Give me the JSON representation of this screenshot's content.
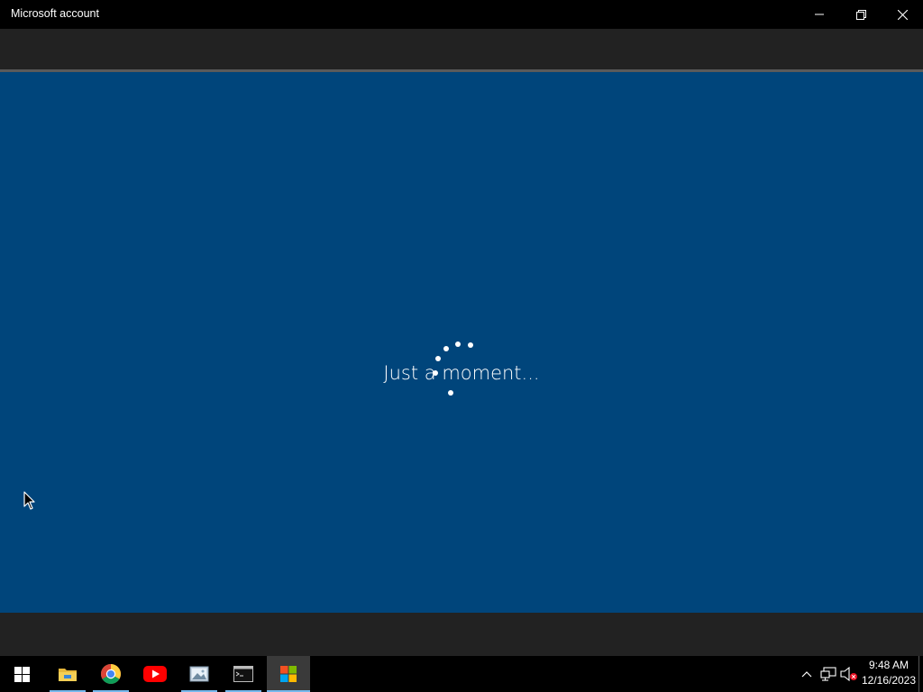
{
  "window": {
    "title": "Microsoft account",
    "controls": {
      "minimize": "minimize-icon",
      "restore": "restore-icon",
      "close": "close-icon"
    }
  },
  "content": {
    "status_text": "Just a moment...",
    "background": "#00457b",
    "spinner": "loading-spinner"
  },
  "taskbar": {
    "start": "windows-start-icon",
    "apps": [
      {
        "name": "File Explorer",
        "icon": "folder-icon",
        "running": true,
        "active": false
      },
      {
        "name": "Google Chrome",
        "icon": "chrome-icon",
        "running": true,
        "active": false
      },
      {
        "name": "YouTube",
        "icon": "youtube-icon",
        "running": false,
        "active": false
      },
      {
        "name": "Photos",
        "icon": "photos-icon",
        "running": true,
        "active": false
      },
      {
        "name": "Command Prompt",
        "icon": "terminal-icon",
        "running": true,
        "active": false
      },
      {
        "name": "Microsoft Store",
        "icon": "microsoft-store-icon",
        "running": true,
        "active": true
      }
    ],
    "tray": {
      "icons": [
        "chevron-up-icon",
        "network-icon",
        "volume-muted-icon"
      ],
      "time": "9:48 AM",
      "date": "12/16/2023"
    },
    "accent": "#76b9ed"
  }
}
